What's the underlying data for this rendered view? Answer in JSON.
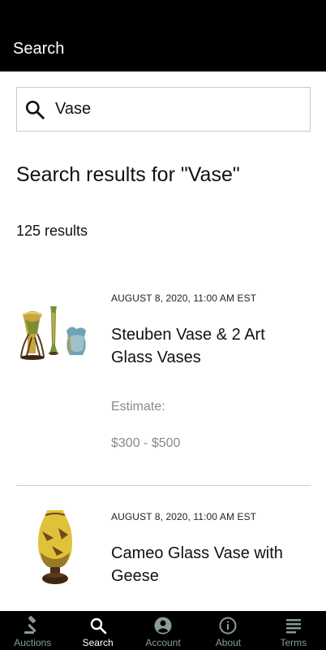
{
  "app_bar": {
    "title": "Search"
  },
  "search": {
    "value": "Vase",
    "icon": "search-icon"
  },
  "results": {
    "heading": "Search results for \"Vase\"",
    "count_label": "125 results"
  },
  "items": [
    {
      "date": "AUGUST 8, 2020, 11:00 AM EST",
      "title": "Steuben Vase & 2 Art Glass Vases",
      "estimate_label": "Estimate:",
      "estimate_value": "$300 - $500"
    },
    {
      "date": "AUGUST 8, 2020, 11:00 AM EST",
      "title": "Cameo Glass Vase with Geese"
    }
  ],
  "bottom_nav": [
    {
      "label": "Auctions",
      "icon": "gavel-icon"
    },
    {
      "label": "Search",
      "icon": "search-icon",
      "active": true
    },
    {
      "label": "Account",
      "icon": "account-icon"
    },
    {
      "label": "About",
      "icon": "info-icon"
    },
    {
      "label": "Terms",
      "icon": "terms-icon"
    }
  ]
}
